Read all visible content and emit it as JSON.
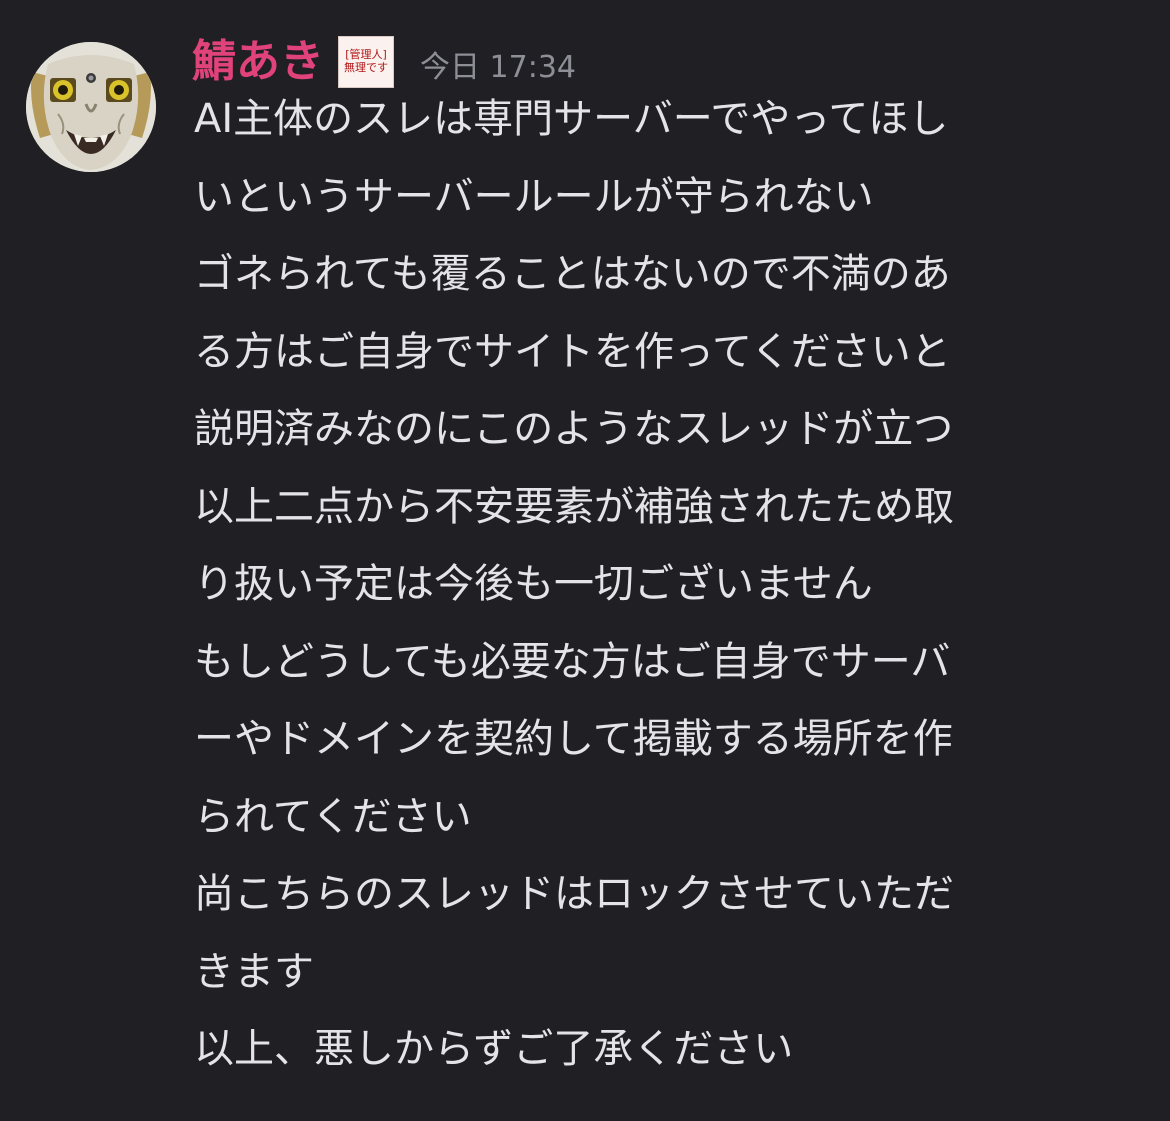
{
  "message": {
    "author": "鯖あき",
    "role_badge": {
      "line1": "[管理人]",
      "line2": "無理です"
    },
    "timestamp": "今日 17:34",
    "avatar_icon": "noh-mask-avatar",
    "lines": [
      "AI主体のスレは専門サーバーでやってほし",
      "いというサーバールールが守られない",
      "ゴネられても覆ることはないので不満のあ",
      "る方はご自身でサイトを作ってくださいと",
      "説明済みなのにこのようなスレッドが立つ",
      "以上二点から不安要素が補強されたため取",
      "り扱い予定は今後も一切ございません",
      "もしどうしても必要な方はご自身でサーバ",
      "ーやドメインを契約して掲載する場所を作",
      "られてください",
      "尚こちらのスレッドはロックさせていただ",
      "きます",
      "以上、悪しからずご了承ください"
    ]
  },
  "colors": {
    "background": "#1f1f24",
    "author": "#e0427a",
    "text": "#e3e3e8",
    "timestamp": "#8e8f96",
    "badge_text": "#b01818"
  }
}
